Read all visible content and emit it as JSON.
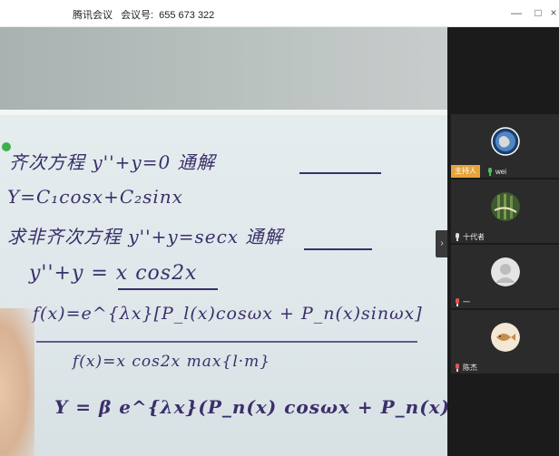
{
  "window": {
    "app_name": "腾讯会议",
    "meeting_id_label": "会议号:",
    "meeting_id": "655 673 322",
    "controls": {
      "minimize": "—",
      "maximize": "□",
      "close": "×"
    }
  },
  "whiteboard": {
    "lines": [
      "齐次方程 y''+y=0 通解",
      "Y=C₁cosx+C₂sinx",
      "求非齐次方程 y''+y=secx 通解",
      "y''+y = x cos2x",
      "f(x)=e^{λx}[P_l(x)cosωx + P_n(x)sinωx]",
      "f(x)=x cos2x     max{l·m}",
      "Y = β e^{λx}(P_n(x) cosωx + P_n(x) sinωx)"
    ]
  },
  "sidebar": {
    "collapse_icon": "chevron-right",
    "participants": [
      {
        "name": "wei",
        "host_badge": "主持人",
        "mic": "active",
        "avatar": "earth"
      },
      {
        "name": "十代者",
        "mic": "normal",
        "avatar": "bamboo"
      },
      {
        "name": "一",
        "mic": "muted",
        "avatar": "default-person"
      },
      {
        "name": "陈杰",
        "mic": "muted",
        "avatar": "fish"
      }
    ]
  }
}
